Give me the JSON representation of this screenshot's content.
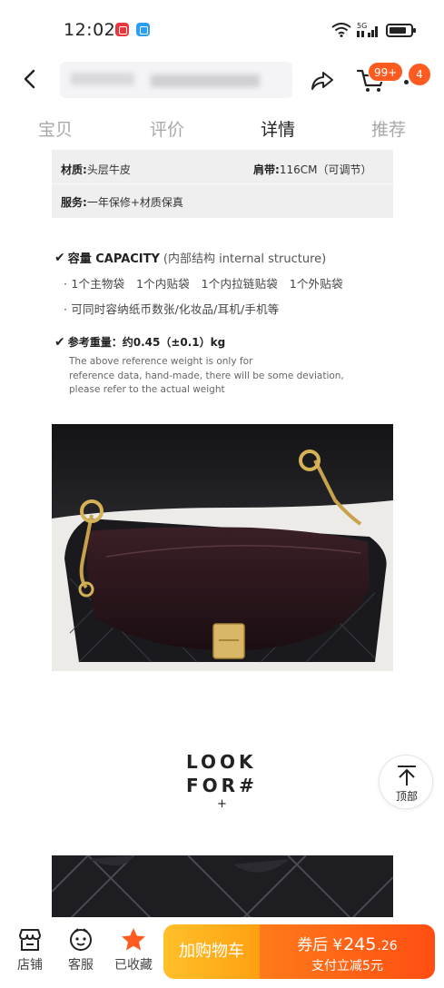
{
  "status_bar": {
    "time": "12:02",
    "network": "5G"
  },
  "nav": {
    "cart_badge": "99+",
    "more_badge": "4"
  },
  "tabs": [
    {
      "label": "宝贝",
      "active": false
    },
    {
      "label": "评价",
      "active": false
    },
    {
      "label": "详情",
      "active": true
    },
    {
      "label": "推荐",
      "active": false
    }
  ],
  "specs": {
    "material_key": "材质:",
    "material_value": "头层牛皮",
    "strap_key": "肩带:",
    "strap_value": "116CM（可调节）",
    "service_key": "服务:",
    "service_value": "一年保修+材质保真"
  },
  "capacity": {
    "heading": "容量 CAPACITY",
    "heading_rest": "(内部结构 internal structure)",
    "line1": "· 1个主物袋　1个内贴袋　1个内拉链贴袋　1个外贴袋",
    "line2": "· 可同时容纳纸币数张/化妆品/耳机/手机等"
  },
  "weight": {
    "heading": "参考重量：约0.45（±0.1）kg",
    "note_line1": "The above reference weight is only for",
    "note_line2": "reference data, hand-made, there will be some deviation,",
    "note_line3": "please refer to the actual weight"
  },
  "look_for": {
    "line1": "LOOK",
    "line2": "FOR#",
    "plus": "+"
  },
  "back_to_top": {
    "label": "顶部"
  },
  "bottom_bar": {
    "store_label": "店铺",
    "service_label": "客服",
    "fav_label": "已收藏",
    "add_cart_label": "加购物车",
    "buy_prefix": "券后",
    "currency": "¥",
    "price_int": "245",
    "price_dec": ".26",
    "buy_sub": "支付立减5元"
  },
  "colors": {
    "accent_orange": "#ff5a1f",
    "cart_btn": "#ffb01f",
    "buy_btn": "#ff5e14",
    "fav_star": "#ff5a1f"
  }
}
